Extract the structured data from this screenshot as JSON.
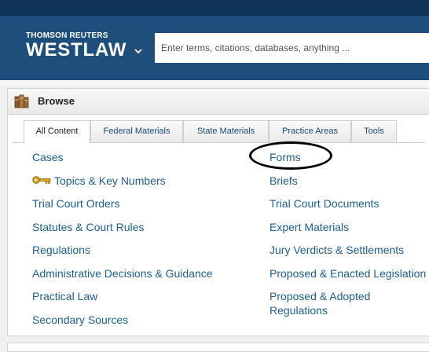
{
  "header": {
    "brand_top": "THOMSON REUTERS",
    "brand_main": "WESTLAW",
    "brand_menu_icon": "chevron-down-icon",
    "search_placeholder": "Enter terms, citations, databases, anything ..."
  },
  "browse": {
    "title": "Browse",
    "icon": "books-icon",
    "active_tab": "All Content",
    "tabs": [
      {
        "label": "All Content"
      },
      {
        "label": "Federal Materials"
      },
      {
        "label": "State Materials"
      },
      {
        "label": "Practice Areas"
      },
      {
        "label": "Tools"
      }
    ],
    "left_links": [
      {
        "label": "Cases"
      },
      {
        "label": "Topics & Key Numbers",
        "icon": "key-icon"
      },
      {
        "label": "Trial Court Orders"
      },
      {
        "label": "Statutes & Court Rules"
      },
      {
        "label": "Regulations"
      },
      {
        "label": "Administrative Decisions & Guidance"
      },
      {
        "label": "Practical Law"
      },
      {
        "label": "Secondary Sources"
      }
    ],
    "right_links": [
      {
        "label": "Forms",
        "annotated": true
      },
      {
        "label": "Briefs"
      },
      {
        "label": "Trial Court Documents"
      },
      {
        "label": "Expert Materials"
      },
      {
        "label": "Jury Verdicts & Settlements"
      },
      {
        "label": "Proposed & Enacted Legislation"
      },
      {
        "label": "Proposed & Adopted",
        "label_line2": "Regulations"
      }
    ]
  },
  "colors": {
    "header_bg": "#1e4f7c",
    "top_strip": "#0f3457",
    "link": "#1b5e95",
    "annotation_circle": "#000000"
  }
}
